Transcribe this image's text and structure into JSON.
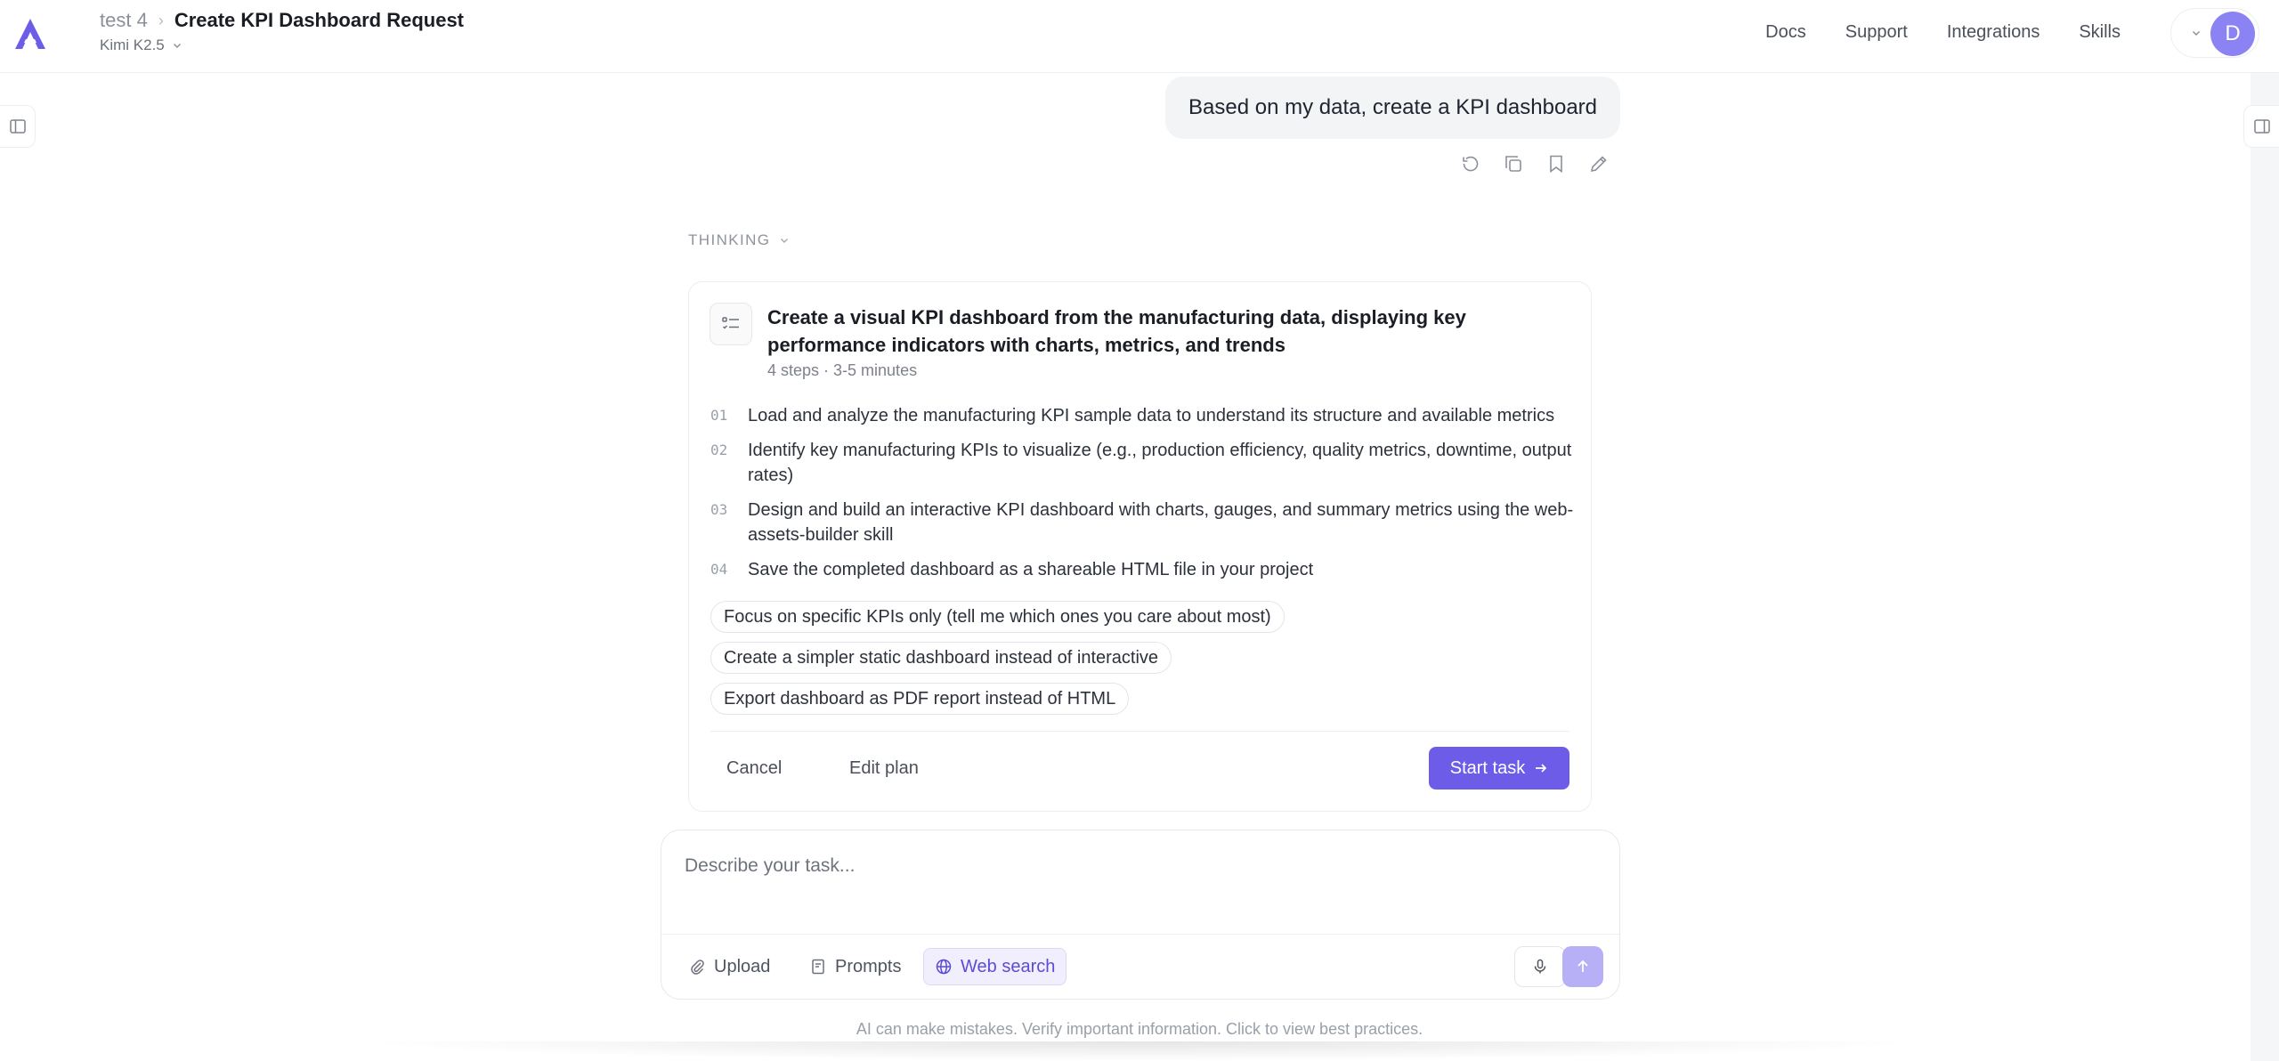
{
  "header": {
    "breadcrumb_parent": "test 4",
    "breadcrumb_separator": "›",
    "title": "Create KPI Dashboard Request",
    "model": "Kimi K2.5",
    "nav": [
      "Docs",
      "Support",
      "Integrations",
      "Skills"
    ],
    "avatar_initial": "D"
  },
  "conversation": {
    "user_message": "Based on my data, create a KPI dashboard",
    "message_actions": [
      "retry-icon",
      "copy-icon",
      "bookmark-icon",
      "edit-icon"
    ],
    "thinking_label": "THINKING"
  },
  "plan": {
    "title": "Create a visual KPI dashboard from the manufacturing data, displaying key performance indicators with charts, metrics, and trends",
    "meta": "4 steps · 3-5 minutes",
    "steps": [
      {
        "num": "01",
        "text": "Load and analyze the manufacturing KPI sample data to understand its structure and available metrics"
      },
      {
        "num": "02",
        "text": "Identify key manufacturing KPIs to visualize (e.g., production efficiency, quality metrics, downtime, output rates)"
      },
      {
        "num": "03",
        "text": "Design and build an interactive KPI dashboard with charts, gauges, and summary metrics using the web-assets-builder skill"
      },
      {
        "num": "04",
        "text": "Save the completed dashboard as a shareable HTML file in your project"
      }
    ],
    "suggestions": [
      "Focus on specific KPIs only (tell me which ones you care about most)",
      "Create a simpler static dashboard instead of interactive",
      "Export dashboard as PDF report instead of HTML"
    ],
    "cancel_label": "Cancel",
    "edit_label": "Edit plan",
    "start_label": "Start task"
  },
  "composer": {
    "placeholder": "Describe your task...",
    "upload_label": "Upload",
    "prompts_label": "Prompts",
    "web_search_label": "Web search"
  },
  "footer": {
    "disclaimer": "AI can make mistakes. Verify important information. Click to view best practices."
  },
  "colors": {
    "accent": "#6c5ce7",
    "avatar": "#8b82f4",
    "send_disabled": "#b8b0f7"
  }
}
